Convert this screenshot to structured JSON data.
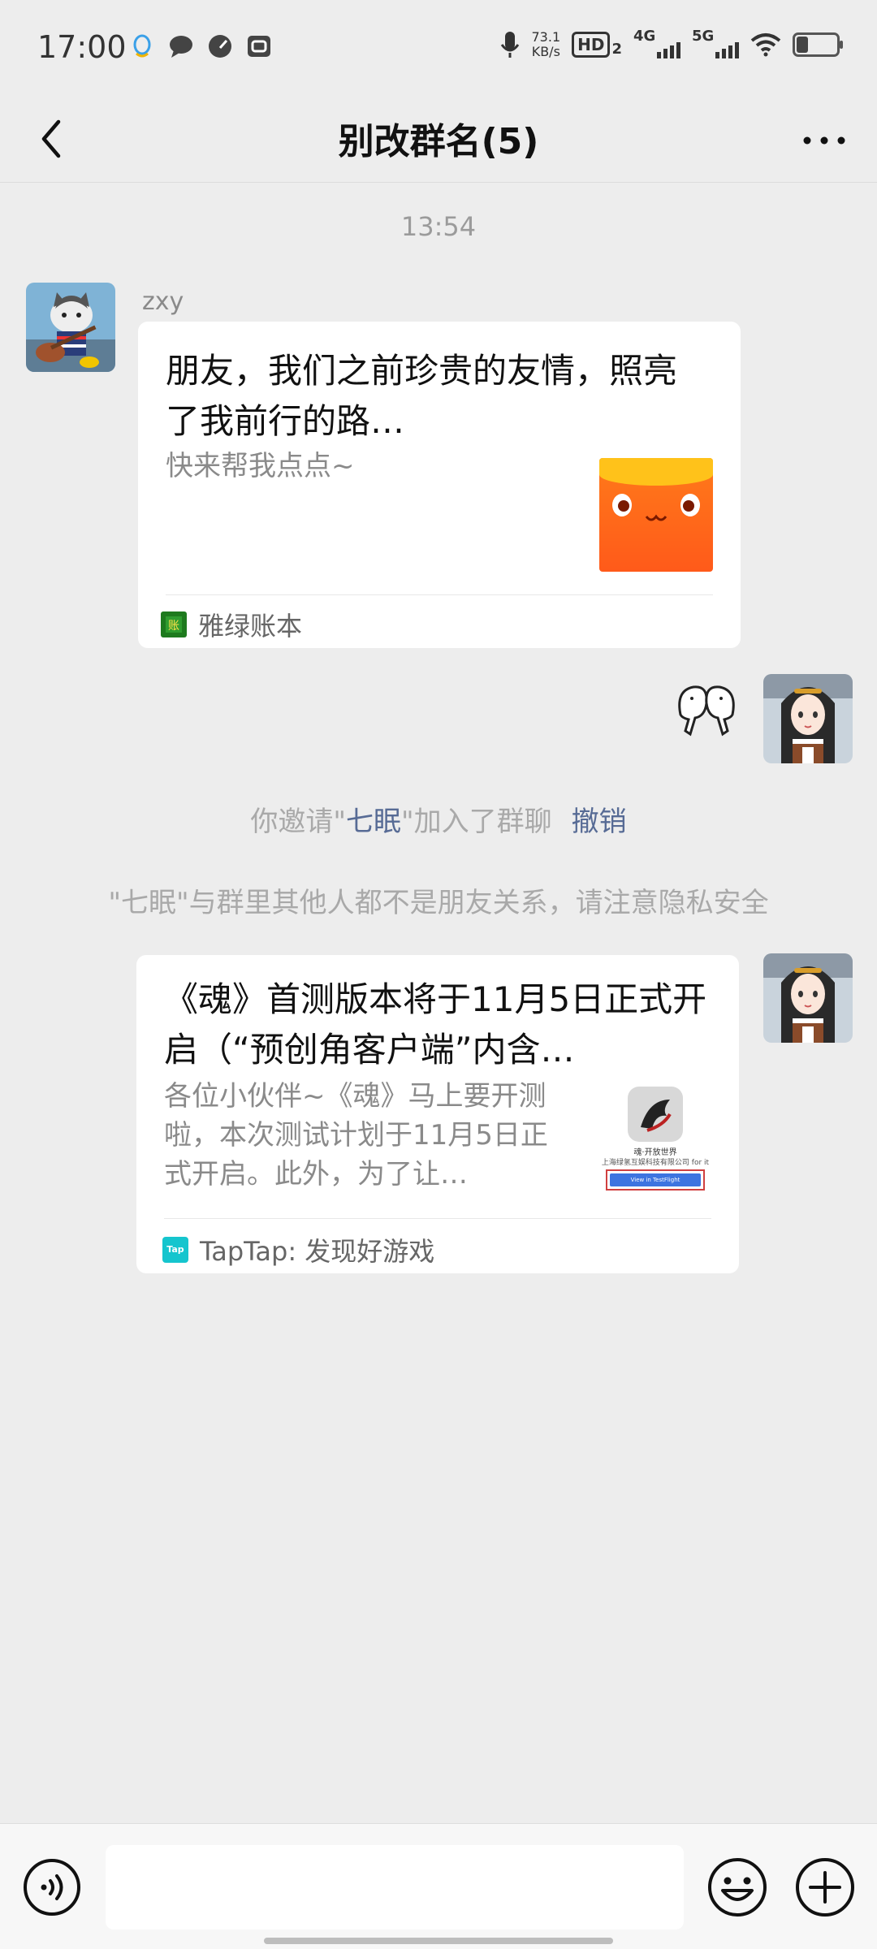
{
  "status_bar": {
    "time": "17:00",
    "speed_value": "73.1",
    "speed_unit": "KB/s",
    "hd": "HD",
    "hd_sub": "2",
    "net1": "4G",
    "net2": "5G",
    "icons": [
      "qq-icon",
      "chat-bubble-icon",
      "speedometer-icon",
      "camera-app-icon",
      "mic-icon",
      "wifi-icon",
      "battery-icon"
    ]
  },
  "nav": {
    "title": "别改群名(5)"
  },
  "chat": {
    "timestamp": "13:54",
    "msg1": {
      "sender": "zxy",
      "title": "朋友，我们之前珍贵的友情，照亮了我前行的路…",
      "desc": "快来帮我点点~",
      "source": "雅绿账本"
    },
    "system1": {
      "prefix": "你邀请\"",
      "name": "七眠",
      "suffix": "\"加入了群聊",
      "action": "撤销"
    },
    "system2": "\"七眠\"与群里其他人都不是朋友关系，请注意隐私安全",
    "msg3": {
      "title": "《魂》首测版本将于11月5日正式开启（“预创角客户端”内含…",
      "desc": "各位小伙伴~《魂》马上要开测啦，本次测试计划于11月5日正式开启。此外，为了让…",
      "source": "TapTap: 发现好游戏",
      "source_logo": "Tap",
      "thumb_caption1": "魂·开放世界",
      "thumb_caption2": "上海绿氢互娱科技有限公司 for it",
      "thumb_button": "View in TestFlight"
    }
  },
  "input": {
    "placeholder": ""
  },
  "colors": {
    "background": "#ededed",
    "link": "#576b95",
    "card": "#ffffff"
  }
}
